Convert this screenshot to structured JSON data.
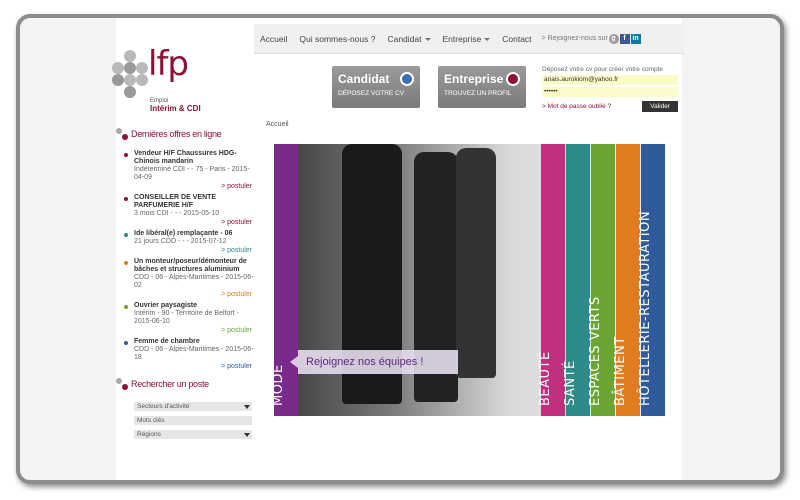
{
  "nav": {
    "items": [
      "Accueil",
      "Qui sommes-nous ?",
      "Candidat",
      "Entreprise",
      "Contact"
    ],
    "join": "> Rejoignez-nous sur"
  },
  "logo": {
    "brand": "lfp",
    "emploi": "Emploi",
    "sub": "Intérim & CDI"
  },
  "header": {
    "candidat": {
      "title": "Candidat",
      "sub": "DÉPOSEZ VOTRE CV"
    },
    "entreprise": {
      "title": "Entreprise",
      "sub": "TROUVEZ UN PROFIL"
    }
  },
  "login": {
    "prompt": "Déposez votre cv pour créer votre compte",
    "email": "anais.aurokiom@yahoo.fr",
    "password": "••••••",
    "forgot": "> Mot de passe oublié ?",
    "submit": "Valider"
  },
  "breadcrumb": "Accueil",
  "sidebar": {
    "offers_title": "Dernières offres en ligne",
    "offers": [
      {
        "title": "Vendeur H/F Chaussures HDG- Chinois mandarin",
        "meta": "Indéterminé CDI - - 75 - Paris - 2015-04-09",
        "apply": "> postuler",
        "color": "#8e1032"
      },
      {
        "title": "CONSEILLER DE VENTE PARFUMERIE H/F",
        "meta": "3 mois CDI - - - 2015-05-10",
        "apply": "> postuler",
        "color": "#8e1032"
      },
      {
        "title": "Ide libéral(e) remplaçante - 06",
        "meta": "21 jours CDD - - - 2015-07-12",
        "apply": "> postuler",
        "color": "#2f8a8a"
      },
      {
        "title": "Un monteur/poseur/démonteur de bâches et structures aluminium",
        "meta": "CDD - 06 - Alpes-Maritimes - 2015-06-02",
        "apply": "> postuler",
        "color": "#e07b1f"
      },
      {
        "title": "Ouvrier paysagiste",
        "meta": "Intérim - 90 - Territoire de Belfort - 2015-06-10",
        "apply": "> postuler",
        "color": "#6aa534"
      },
      {
        "title": "Femme de chambre",
        "meta": "CDD - 06 - Alpes-Maritimes - 2015-06-18",
        "apply": "> postuler",
        "color": "#2f5b9a"
      }
    ],
    "search_title": "Rechercher un poste",
    "sector": "Secteurs d'activité",
    "keywords": "Mots clés",
    "regions": "Régions"
  },
  "banner": {
    "mode": "MODE",
    "join": "Rejoignez nos équipes !",
    "strips": [
      {
        "label": "BEAUTÉ",
        "color": "#c0307f"
      },
      {
        "label": "SANTÉ",
        "color": "#2f8a8a"
      },
      {
        "label": "ESPACES VERTS",
        "color": "#6aa534"
      },
      {
        "label": "BÂTIMENT",
        "color": "#e07b1f"
      },
      {
        "label": "HÔTELLERIE-RESTAURATION",
        "color": "#2f5b9a"
      }
    ],
    "mode_color": "#7a2a8a"
  }
}
